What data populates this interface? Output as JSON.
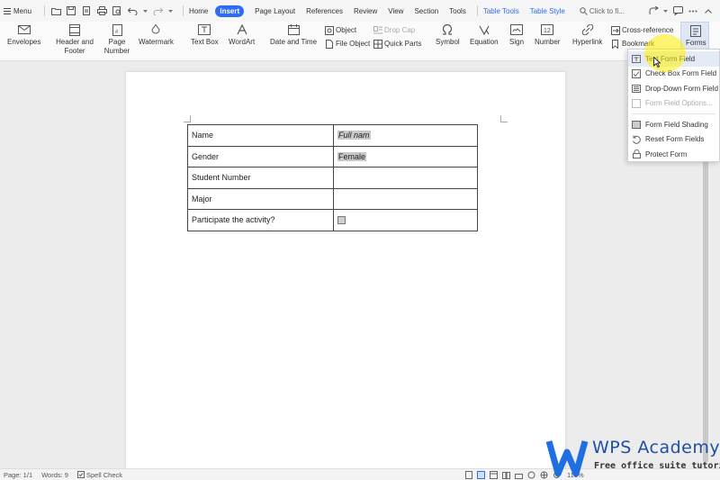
{
  "menubar": {
    "menu_label": "Menu",
    "tabs": [
      "Home",
      "Insert",
      "Page Layout",
      "References",
      "Review",
      "View",
      "Section",
      "Tools"
    ],
    "context_tabs": [
      "Table Tools",
      "Table Style"
    ],
    "search_placeholder": "Click to fi..."
  },
  "ribbon": {
    "envelopes": "Envelopes",
    "header_footer": "Header and Footer",
    "page_number": "Page Number",
    "watermark": "Watermark",
    "text_box": "Text Box",
    "wordart": "WordArt",
    "date_time": "Date and Time",
    "object": "Object",
    "file_object": "File Object",
    "drop_cap": "Drop Cap",
    "quick_parts": "Quick Parts",
    "symbol": "Symbol",
    "equation": "Equation",
    "sign": "Sign",
    "number": "Number",
    "hyperlink": "Hyperlink",
    "cross_reference": "Cross-reference",
    "bookmark": "Bookmark",
    "forms": "Forms"
  },
  "forms_menu": {
    "items": [
      {
        "label": "Text Form Field",
        "disabled": false
      },
      {
        "label": "Check Box Form Field",
        "disabled": false
      },
      {
        "label": "Drop-Down Form Field",
        "disabled": false
      },
      {
        "label": "Form Field Options...",
        "disabled": true
      },
      {
        "label": "Form Field Shading",
        "disabled": false
      },
      {
        "label": "Reset Form Fields",
        "disabled": false
      },
      {
        "label": "Protect Form",
        "disabled": false
      }
    ]
  },
  "document": {
    "rows": [
      {
        "label": "Name",
        "value": "Full nam"
      },
      {
        "label": "Gender",
        "value": "Female"
      },
      {
        "label": "Student Number",
        "value": ""
      },
      {
        "label": "Major",
        "value": ""
      },
      {
        "label": "Participate the activity?",
        "value": ""
      }
    ]
  },
  "statusbar": {
    "page": "Page: 1/1",
    "words": "Words: 9",
    "spell_check": "Spell Check",
    "zoom": "110%"
  },
  "watermark": {
    "brand": "WPS Academy",
    "tagline": "Free office suite tutorials"
  },
  "colors": {
    "accent": "#2f6cf6",
    "highlight": "#fff000",
    "brand": "#1f4fa6"
  }
}
